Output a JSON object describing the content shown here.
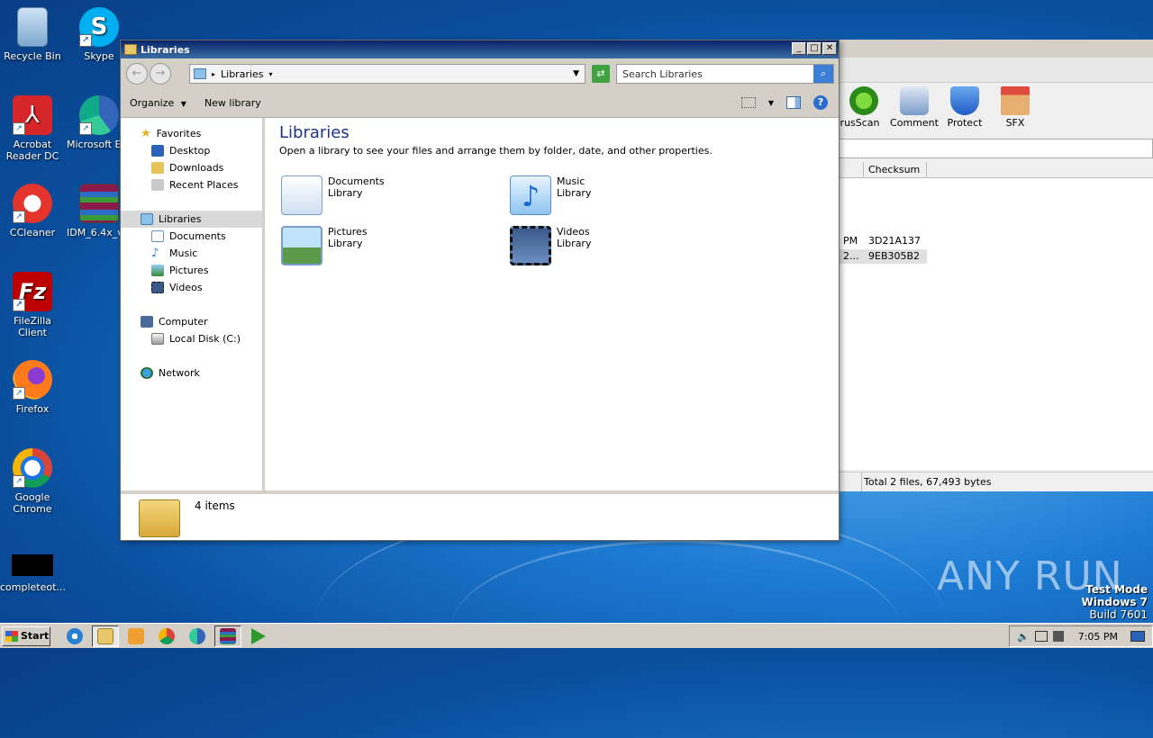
{
  "desktop": {
    "icons": [
      {
        "label": "Recycle Bin"
      },
      {
        "label": "Skype"
      },
      {
        "label": "Acrobat Reader DC"
      },
      {
        "label": "Microsoft Ed"
      },
      {
        "label": "CCleaner"
      },
      {
        "label": "IDM_6.4x_v"
      },
      {
        "label": "FileZilla Client"
      },
      {
        "label": "Firefox"
      },
      {
        "label": "Google Chrome"
      },
      {
        "label": "completeot..."
      }
    ]
  },
  "winrar": {
    "tools": [
      "irusScan",
      "Comment",
      "Protect",
      "SFX"
    ],
    "col_checksum": "Checksum",
    "rows": [
      {
        "left": "PM",
        "checksum": "3D21A137"
      },
      {
        "left": "2...",
        "checksum": "9EB305B2"
      }
    ],
    "status": "Total 2 files, 67,493 bytes"
  },
  "explorer": {
    "title": "Libraries",
    "address": "Libraries",
    "search_placeholder": "Search Libraries",
    "cmd_organize": "Organize",
    "cmd_new_library": "New library",
    "nav": {
      "favorites": "Favorites",
      "desktop": "Desktop",
      "downloads": "Downloads",
      "recent": "Recent Places",
      "libraries": "Libraries",
      "documents": "Documents",
      "music": "Music",
      "pictures": "Pictures",
      "videos": "Videos",
      "computer": "Computer",
      "localdisk": "Local Disk (C:)",
      "network": "Network"
    },
    "heading": "Libraries",
    "subheading": "Open a library to see your files and arrange them by folder, date, and other properties.",
    "libraries": [
      {
        "name": "Documents",
        "type": "Library"
      },
      {
        "name": "Music",
        "type": "Library"
      },
      {
        "name": "Pictures",
        "type": "Library"
      },
      {
        "name": "Videos",
        "type": "Library"
      }
    ],
    "item_count": "4 items"
  },
  "taskbar": {
    "start": "Start",
    "clock": "7:05 PM"
  },
  "watermark": "ANY RUN",
  "testmode": {
    "line1": "Test Mode",
    "line2": "Windows 7",
    "line3": "Build 7601"
  }
}
